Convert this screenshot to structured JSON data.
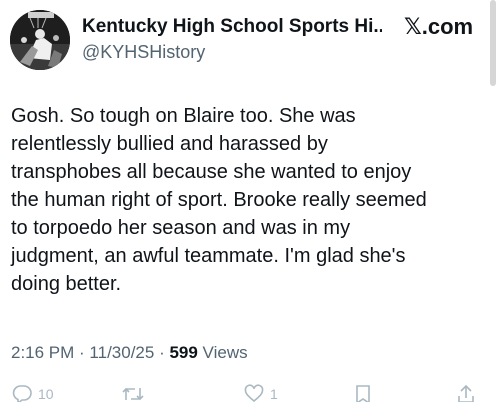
{
  "author": {
    "name": "Kentucky High School Sports Hi...",
    "handle": "@KYHSHistory"
  },
  "brand": "𝕏.com",
  "tweet": {
    "lines": [
      "Gosh. So tough on Blaire too. She was",
      "relentlessly bullied and harassed by",
      "transphobes all because she wanted to enjoy",
      "the human right of sport. Brooke really seemed",
      "to torpoedo her season and was in my",
      "judgment, an awful teammate. I'm glad she's",
      "doing better."
    ]
  },
  "meta": {
    "time": "2:16 PM",
    "sep1": " · ",
    "date": "11/30/25",
    "sep2": " · ",
    "views_count": "599",
    "views_label": " Views"
  },
  "actions": {
    "replies": "10",
    "reposts": "",
    "likes": "1"
  },
  "colors": {
    "text": "#0f1419",
    "secondary": "#536471",
    "faded_icon": "#aab8c2"
  },
  "icons": {
    "avatar": "basketball-photo-avatar",
    "reply": "reply-icon",
    "repost": "repost-icon",
    "like": "heart-icon",
    "bookmark": "bookmark-icon",
    "share": "share-icon"
  }
}
